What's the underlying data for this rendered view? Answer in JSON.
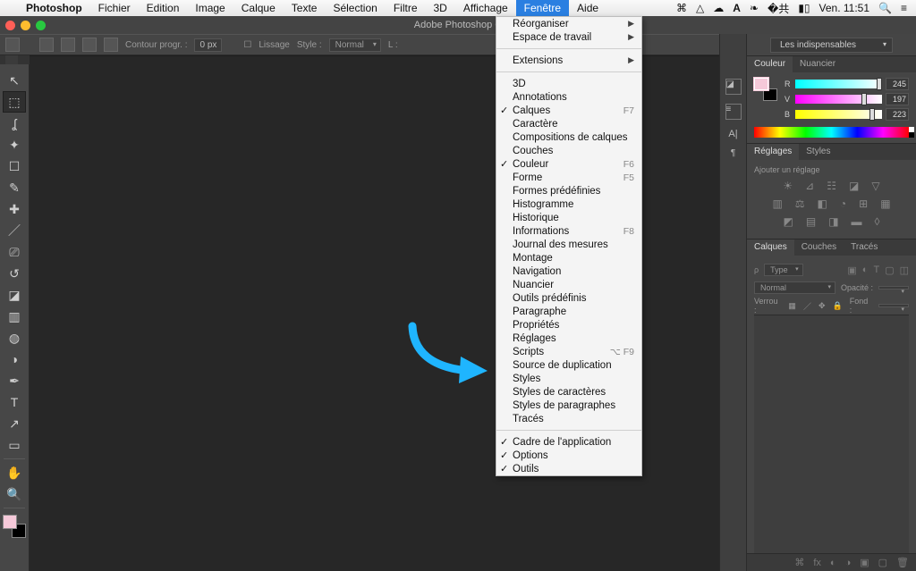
{
  "menubar": {
    "apple": "",
    "items": [
      "Photoshop",
      "Fichier",
      "Edition",
      "Image",
      "Calque",
      "Texte",
      "Sélection",
      "Filtre",
      "3D",
      "Affichage",
      "Fenêtre",
      "Aide"
    ],
    "active_index": 10,
    "right": {
      "time_label": "Ven. 11:51"
    }
  },
  "titlebar": {
    "app_title": "Adobe Photoshop C"
  },
  "options_bar": {
    "contour_label": "Contour progr. :",
    "contour_value": "0 px",
    "lissage_label": "Lissage",
    "style_label": "Style :",
    "style_value": "Normal",
    "L_label": "L :",
    "workspace": "Les indispensables"
  },
  "tools": [
    {
      "name": "move-tool",
      "glyph": "↖"
    },
    {
      "name": "marquee-tool",
      "glyph": "▭",
      "selected": true
    },
    {
      "name": "lasso-tool",
      "glyph": "ɕ"
    },
    {
      "name": "magic-wand-tool",
      "glyph": "✦"
    },
    {
      "name": "crop-tool",
      "glyph": "✂"
    },
    {
      "name": "eyedropper-tool",
      "glyph": "✎"
    },
    {
      "name": "healing-tool",
      "glyph": "✚"
    },
    {
      "name": "brush-tool",
      "glyph": "🖌"
    },
    {
      "name": "stamp-tool",
      "glyph": "⎚"
    },
    {
      "name": "history-brush-tool",
      "glyph": "↺"
    },
    {
      "name": "eraser-tool",
      "glyph": "◧"
    },
    {
      "name": "gradient-tool",
      "glyph": "▥"
    },
    {
      "name": "blur-tool",
      "glyph": "◍"
    },
    {
      "name": "dodge-tool",
      "glyph": "●"
    },
    {
      "name": "pen-tool",
      "glyph": "✒"
    },
    {
      "name": "type-tool",
      "glyph": "T"
    },
    {
      "name": "path-tool",
      "glyph": "↗"
    },
    {
      "name": "shape-tool",
      "glyph": "▭"
    },
    {
      "name": "hand-tool",
      "glyph": "✋"
    },
    {
      "name": "zoom-tool",
      "glyph": "🔍"
    }
  ],
  "fg_color": "#f5c9d9",
  "bg_color": "#000000",
  "dropdown": {
    "groups": [
      [
        {
          "label": "Réorganiser",
          "submenu": true
        },
        {
          "label": "Espace de travail",
          "submenu": true
        }
      ],
      [
        {
          "label": "Extensions",
          "submenu": true
        }
      ],
      [
        {
          "label": "3D"
        },
        {
          "label": "Annotations"
        },
        {
          "label": "Calques",
          "checked": true,
          "shortcut": "F7"
        },
        {
          "label": "Caractère"
        },
        {
          "label": "Compositions de calques"
        },
        {
          "label": "Couches"
        },
        {
          "label": "Couleur",
          "checked": true,
          "shortcut": "F6"
        },
        {
          "label": "Forme",
          "shortcut": "F5"
        },
        {
          "label": "Formes prédéfinies"
        },
        {
          "label": "Histogramme"
        },
        {
          "label": "Historique"
        },
        {
          "label": "Informations",
          "shortcut": "F8"
        },
        {
          "label": "Journal des mesures"
        },
        {
          "label": "Montage"
        },
        {
          "label": "Navigation"
        },
        {
          "label": "Nuancier"
        },
        {
          "label": "Outils prédéfinis"
        },
        {
          "label": "Paragraphe"
        },
        {
          "label": "Propriétés"
        },
        {
          "label": "Réglages"
        },
        {
          "label": "Scripts",
          "shortcut": "⌥ F9"
        },
        {
          "label": "Source de duplication"
        },
        {
          "label": "Styles"
        },
        {
          "label": "Styles de caractères"
        },
        {
          "label": "Styles de paragraphes"
        },
        {
          "label": "Tracés"
        }
      ],
      [
        {
          "label": "Cadre de l'application",
          "checked": true
        },
        {
          "label": "Options",
          "checked": true
        },
        {
          "label": "Outils",
          "checked": true
        }
      ]
    ]
  },
  "panels": {
    "couleur": {
      "tab1": "Couleur",
      "tab2": "Nuancier",
      "r_label": "R",
      "v_label": "V",
      "b_label": "B",
      "r_value": "245",
      "v_value": "197",
      "b_value": "223"
    },
    "reglages": {
      "tab1": "Réglages",
      "tab2": "Styles",
      "title": "Ajouter un réglage"
    },
    "calques": {
      "tab1": "Calques",
      "tab2": "Couches",
      "tab3": "Tracés",
      "filter": "Type",
      "blend": "Normal",
      "opacity_label": "Opacité :",
      "lock_label": "Verrou :",
      "fill_label": "Fond :"
    }
  }
}
